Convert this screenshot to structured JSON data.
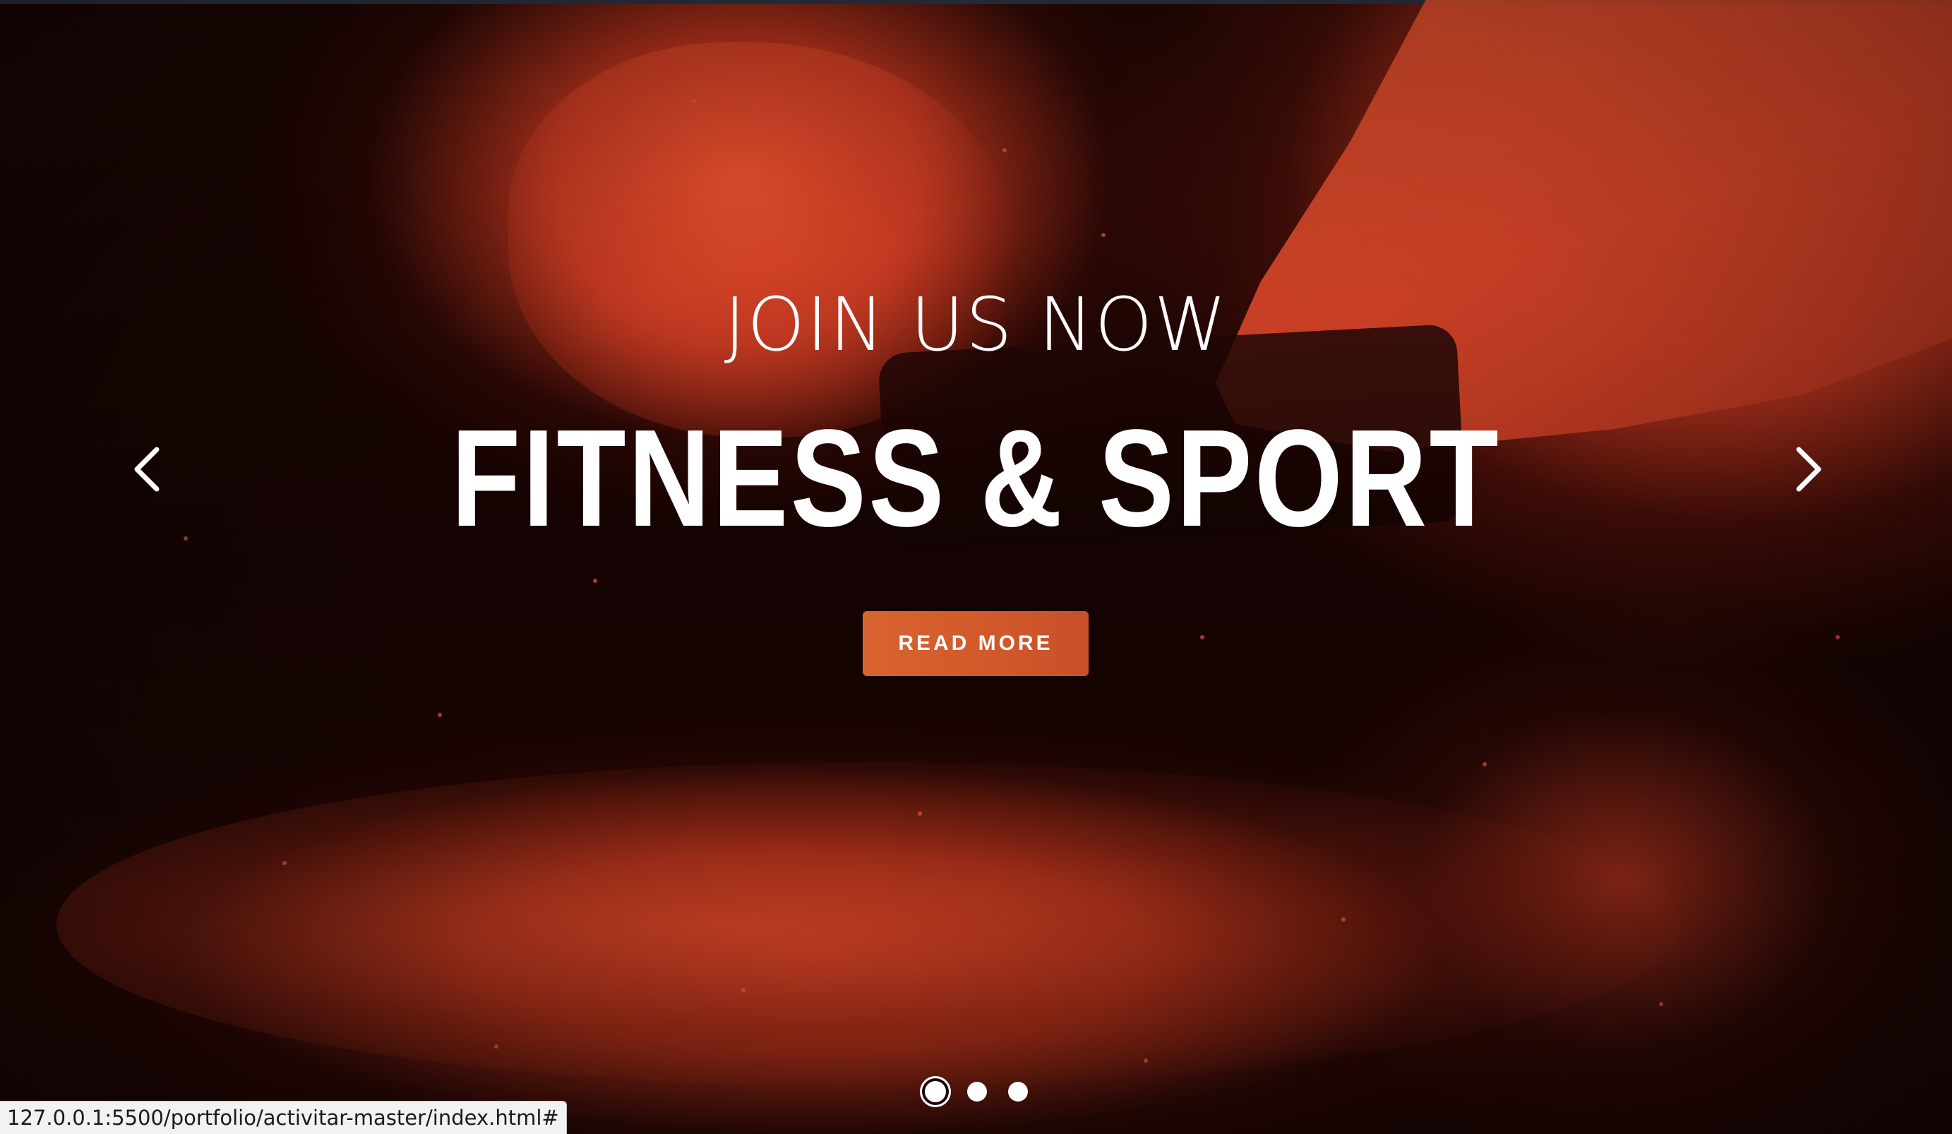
{
  "hero": {
    "subtitle": "JOIN US NOW",
    "title": "FITNESS & SPORT",
    "cta_label": "READ MORE",
    "accent_color": "#d25a2b",
    "prev_icon": "chevron-left-icon",
    "next_icon": "chevron-right-icon"
  },
  "carousel": {
    "slide_count": 3,
    "active_index": 0
  },
  "status_bar": {
    "url": "127.0.0.1:5500/portfolio/activitar-master/index.html#"
  }
}
